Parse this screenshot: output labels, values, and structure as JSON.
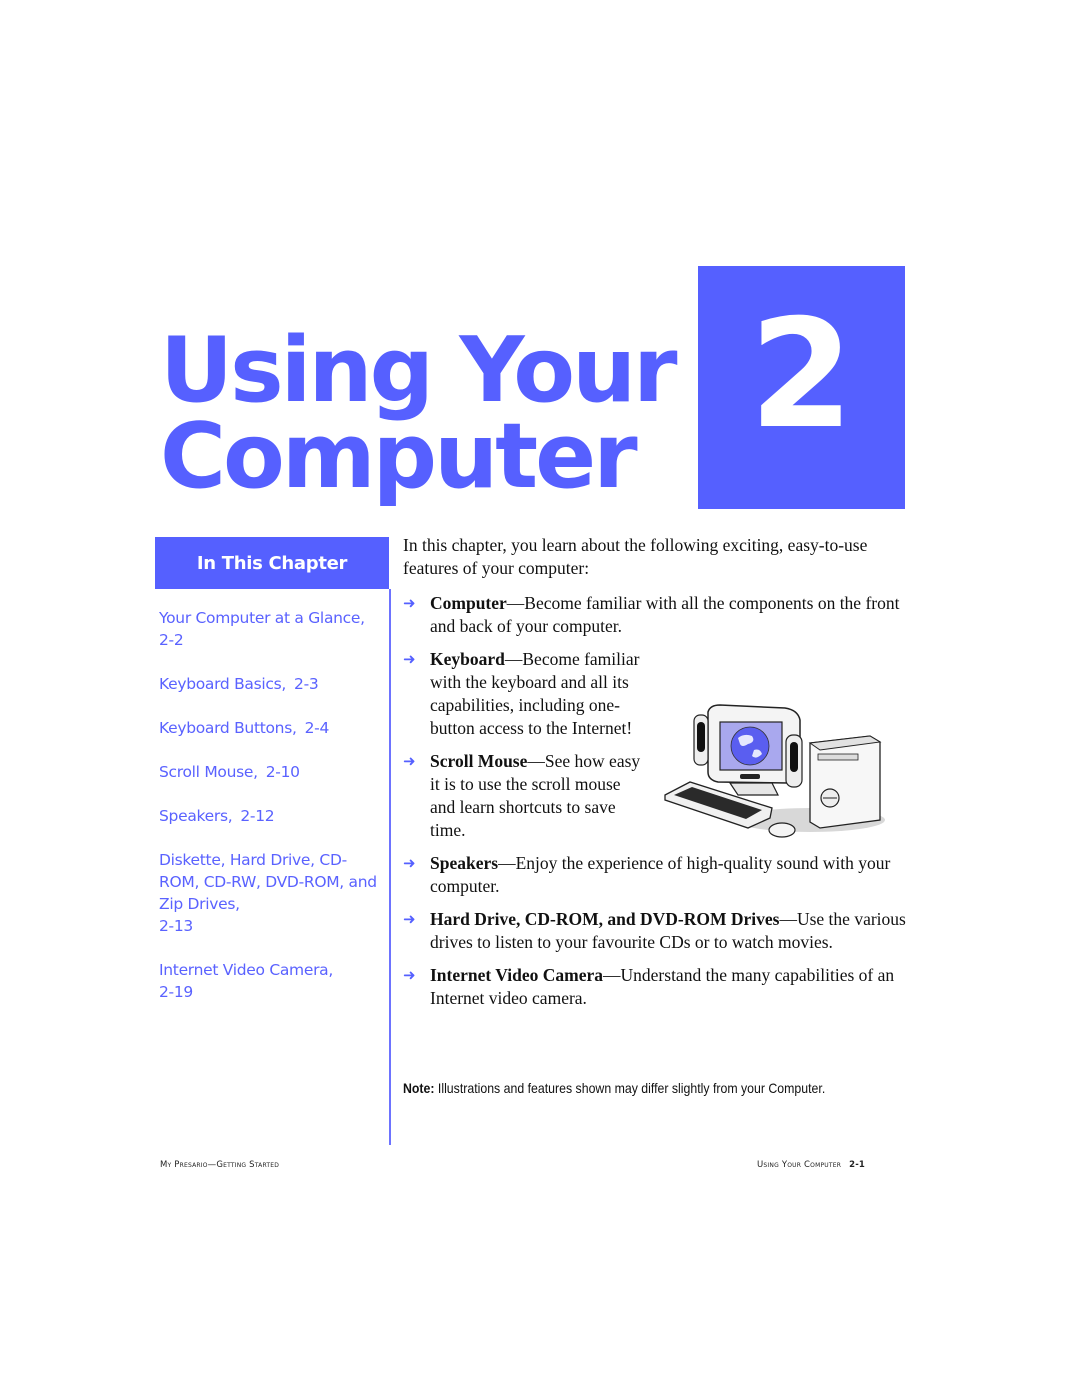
{
  "title": {
    "line1": "Using Your",
    "line2": "Computer",
    "chapter_number": "2"
  },
  "colors": {
    "accent": "#5560ff",
    "text": "#111111",
    "background": "#ffffff"
  },
  "sidebar": {
    "header": "In This Chapter",
    "items": [
      {
        "label": "Your Computer at a Glance,",
        "page": "2-2"
      },
      {
        "label": "Keyboard Basics,",
        "page": "2-3"
      },
      {
        "label": "Keyboard Buttons,",
        "page": "2-4"
      },
      {
        "label": "Scroll Mouse,",
        "page": "2-10"
      },
      {
        "label": "Speakers,",
        "page": "2-12"
      },
      {
        "label": "Diskette, Hard Drive, CD-ROM, CD-RW, DVD-ROM, and Zip Drives,",
        "page": "2-13"
      },
      {
        "label": "Internet Video Camera,",
        "page": "2-19"
      }
    ]
  },
  "main": {
    "intro": "In this chapter, you learn about the following exciting, easy-to-use features of your computer:",
    "bullet_icon": "right-arrow-icon",
    "bullets": [
      {
        "term": "Computer",
        "text": "—Become familiar with all the components on the front and back of your computer."
      },
      {
        "term": "Keyboard",
        "text": "—Become familiar with the keyboard and all its capabilities, including one-button access to the Internet!"
      },
      {
        "term": "Scroll Mouse",
        "text": "—See how easy it is to use the scroll mouse and learn shortcuts to save time."
      },
      {
        "term": "Speakers",
        "text": "—Enjoy the experience of high-quality sound with your computer."
      },
      {
        "term": "Hard Drive, CD-ROM, and DVD-ROM Drives",
        "text": "—Use the various drives to listen to your favourite CDs or to watch movies."
      },
      {
        "term": "Internet Video Camera",
        "text": "—Understand the many capabilities of an Internet video camera."
      }
    ],
    "illustration": "desktop-computer-illustration",
    "note_label": "Note:",
    "note_text": " Illustrations and features shown may differ slightly from your Computer."
  },
  "footer": {
    "left": "My Presario—Getting Started",
    "right": "Using Your Computer",
    "page": "2-1"
  }
}
